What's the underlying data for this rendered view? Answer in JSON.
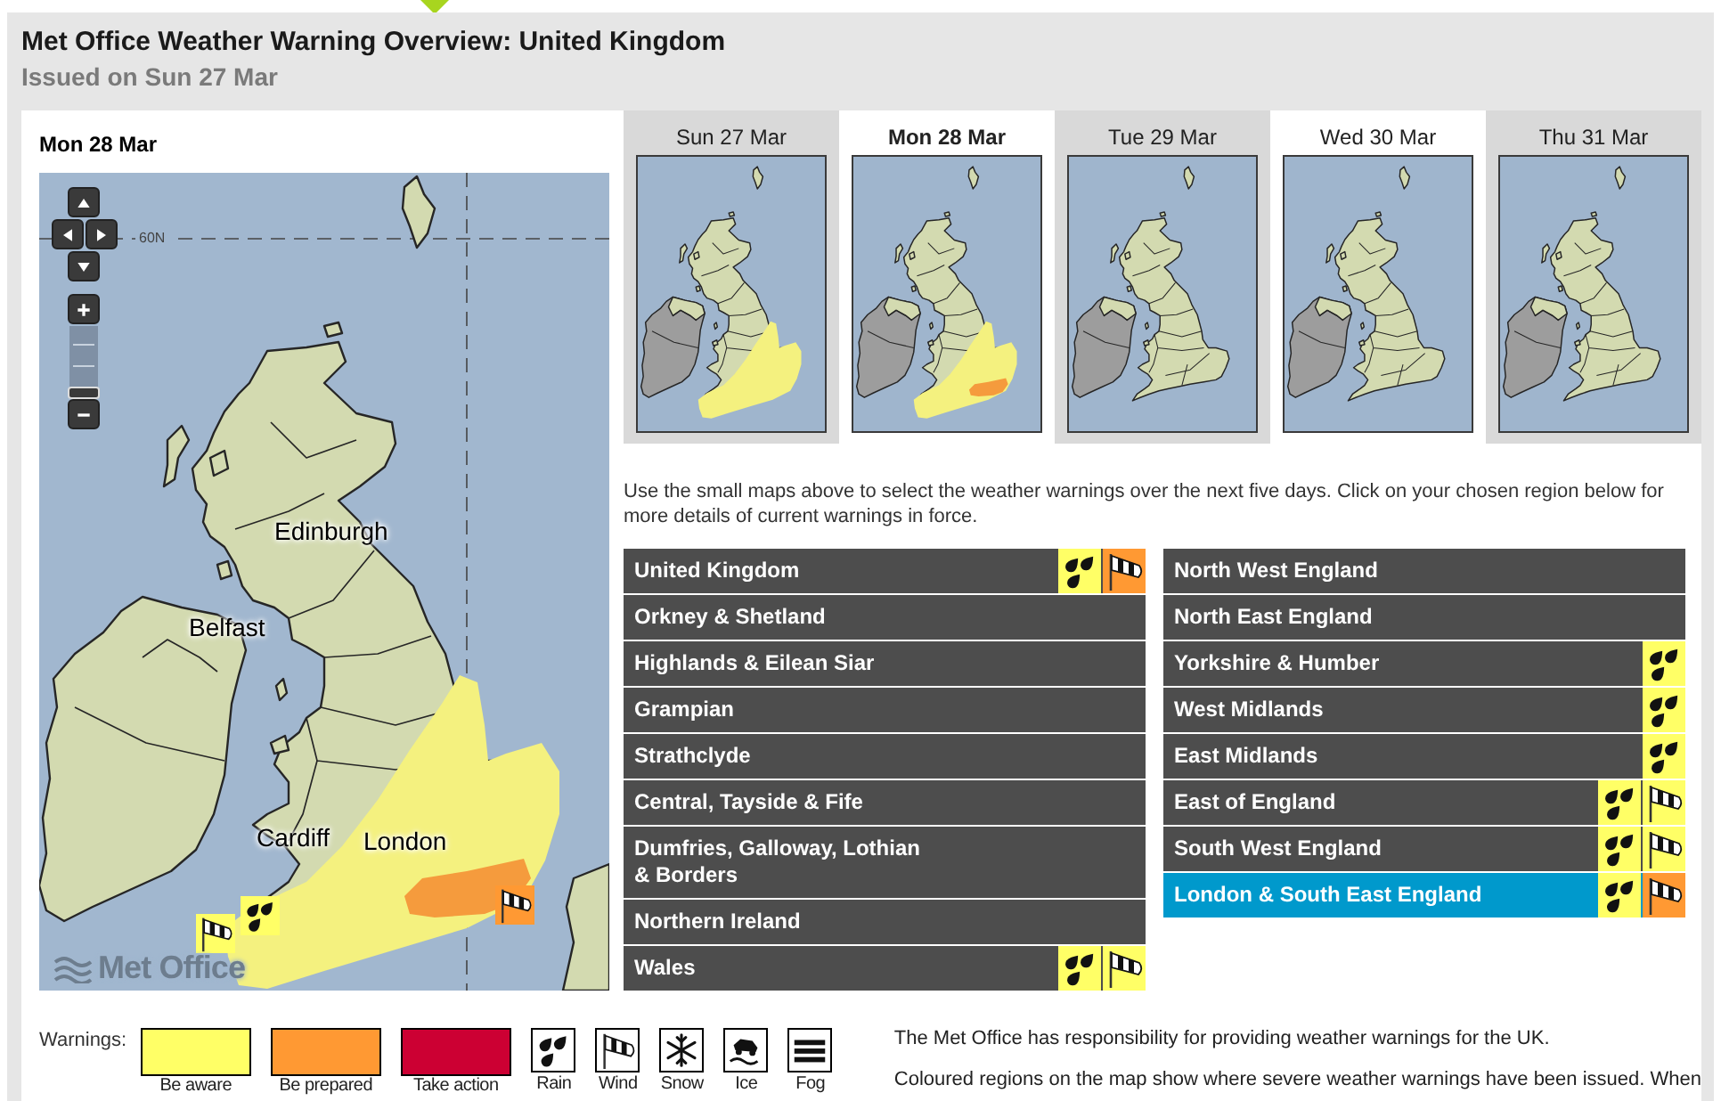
{
  "header": {
    "title": "Met Office Weather Warning Overview: United Kingdom",
    "subtitle": "Issued on Sun 27 Mar"
  },
  "map": {
    "title": "Mon 28 Mar",
    "latitude_label": "60N",
    "zoom_slider": {
      "level": 0
    },
    "warning_areas": [
      {
        "color": "#f4f17f"
      },
      {
        "color": "#f59b3d"
      }
    ],
    "markers": [
      {
        "kind": "wind",
        "color": "#ffff66"
      },
      {
        "kind": "rain",
        "color": "#ffff66"
      },
      {
        "kind": "wind",
        "color": "#ff9933"
      }
    ],
    "cities": [
      "Edinburgh",
      "Belfast",
      "Cardiff",
      "London"
    ],
    "logo": "Met Office"
  },
  "days": [
    {
      "label": "Sun 27 Mar",
      "selected": false,
      "highlighted": false,
      "warning_areas": [
        {
          "color": "#f4f17f"
        }
      ]
    },
    {
      "label": "Mon 28 Mar",
      "selected": true,
      "highlighted": true,
      "warning_areas": [
        {
          "color": "#f4f17f"
        },
        {
          "color": "#f59b3d"
        }
      ]
    },
    {
      "label": "Tue 29 Mar",
      "selected": false,
      "highlighted": false
    },
    {
      "label": "Wed 30 Mar",
      "selected": false,
      "highlighted": true
    },
    {
      "label": "Thu 31 Mar",
      "selected": false,
      "highlighted": false
    }
  ],
  "instructions": "Use the small maps above to select the weather warnings over the next five days. Click on your chosen region below for more details of current warnings in force.",
  "region_columns": [
    [
      {
        "name": "United Kingdom",
        "selected": false,
        "warnings": [
          {
            "kind": "rain",
            "color": "#ffff66"
          },
          {
            "kind": "wind",
            "color": "#ff9933"
          }
        ]
      },
      {
        "name": "Orkney & Shetland",
        "selected": false
      },
      {
        "name": "Highlands & Eilean Siar",
        "selected": false
      },
      {
        "name": "Grampian",
        "selected": false
      },
      {
        "name": "Strathclyde",
        "selected": false
      },
      {
        "name": "Central, Tayside & Fife",
        "selected": false
      },
      {
        "name": "Dumfries, Galloway, Lothian\n& Borders",
        "selected": false
      },
      {
        "name": "Northern Ireland",
        "selected": false
      },
      {
        "name": "Wales",
        "selected": false,
        "warnings": [
          {
            "kind": "rain",
            "color": "#ffff66"
          },
          {
            "kind": "wind",
            "color": "#ffff66"
          }
        ]
      }
    ],
    [
      {
        "name": "North West England",
        "selected": false
      },
      {
        "name": "North East England",
        "selected": false
      },
      {
        "name": "Yorkshire & Humber",
        "selected": false,
        "warnings": [
          {
            "kind": "rain",
            "color": "#ffff66"
          }
        ]
      },
      {
        "name": "West Midlands",
        "selected": false,
        "warnings": [
          {
            "kind": "rain",
            "color": "#ffff66"
          }
        ]
      },
      {
        "name": "East Midlands",
        "selected": false,
        "warnings": [
          {
            "kind": "rain",
            "color": "#ffff66"
          }
        ]
      },
      {
        "name": "East of England",
        "selected": false,
        "warnings": [
          {
            "kind": "rain",
            "color": "#ffff66"
          },
          {
            "kind": "wind",
            "color": "#ffff66"
          }
        ]
      },
      {
        "name": "South West England",
        "selected": false,
        "warnings": [
          {
            "kind": "rain",
            "color": "#ffff66"
          },
          {
            "kind": "wind",
            "color": "#ffff66"
          }
        ]
      },
      {
        "name": "London & South East England",
        "selected": true,
        "warnings": [
          {
            "kind": "rain",
            "color": "#ffff66"
          },
          {
            "kind": "wind",
            "color": "#ff9933"
          }
        ]
      }
    ]
  ],
  "legend": {
    "title": "Warnings:",
    "levels": [
      {
        "label": "Be aware",
        "color": "#ffff66"
      },
      {
        "label": "Be prepared",
        "color": "#ff9933"
      },
      {
        "label": "Take action",
        "color": "#cc0033"
      }
    ],
    "types": [
      {
        "label": "Rain",
        "kind": "rain"
      },
      {
        "label": "Wind",
        "kind": "wind"
      },
      {
        "label": "Snow",
        "kind": "snow"
      },
      {
        "label": "Ice",
        "kind": "ice"
      },
      {
        "label": "Fog",
        "kind": "fog"
      }
    ]
  },
  "info": [
    "The Met Office has responsibility for providing weather warnings for the UK.",
    "Coloured regions on the map show where severe weather warnings have been issued. When"
  ]
}
